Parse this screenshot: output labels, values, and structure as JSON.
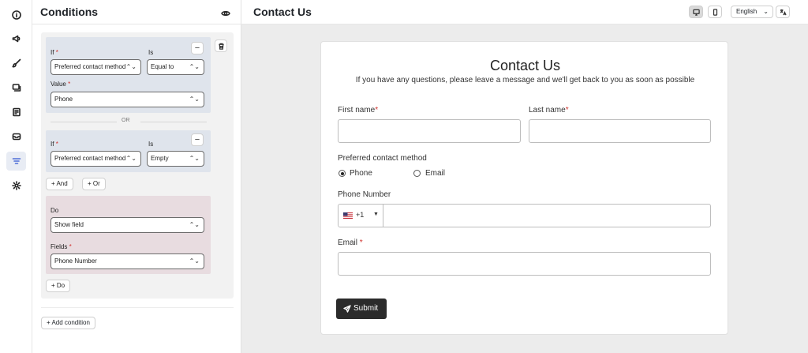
{
  "conditions_panel": {
    "title": "Conditions",
    "condition_1": {
      "if_label": "If",
      "is_label": "Is",
      "field_value": "Preferred contact method",
      "operator_value": "Equal to",
      "value_label": "Value",
      "value_value": "Phone"
    },
    "or_label": "OR",
    "condition_2": {
      "if_label": "If",
      "is_label": "Is",
      "field_value": "Preferred contact method",
      "operator_value": "Empty"
    },
    "and_button": "+ And",
    "or_button": "+ Or",
    "do_label": "Do",
    "do_value": "Show field",
    "fields_label": "Fields",
    "fields_value": "Phone Number",
    "do_button": "+ Do",
    "add_condition": "+ Add condition"
  },
  "main": {
    "title": "Contact Us",
    "language": "English"
  },
  "form": {
    "title": "Contact Us",
    "subtitle": "If you have any questions, please leave a message and we'll get back to you as soon as possible",
    "first_name": "First name",
    "last_name": "Last name",
    "preferred_contact": "Preferred contact method",
    "option_phone": "Phone",
    "option_email": "Email",
    "selected_option": "Phone",
    "phone_number": "Phone Number",
    "country_code": "+1",
    "email": "Email",
    "submit": "Submit"
  },
  "icons": {
    "rail": [
      "info-icon",
      "megaphone-icon",
      "brush-icon",
      "layers-icon",
      "receipt-icon",
      "inbox-icon",
      "filter-icon",
      "settings-icon"
    ],
    "active_rail": "filter-icon",
    "accent": "#4f6fd8",
    "required": "#d0312d"
  }
}
